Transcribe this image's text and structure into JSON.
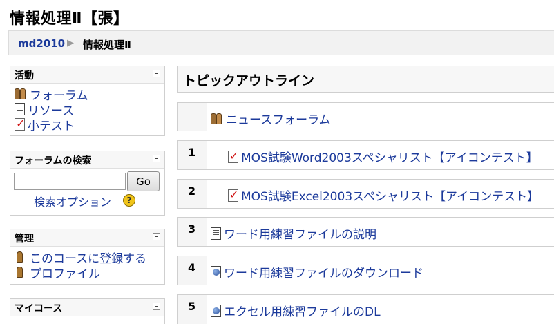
{
  "course": {
    "title": "情報処理Ⅱ【張】"
  },
  "breadcrumb": {
    "home": "md2010",
    "separator": "▶",
    "current": "情報処理Ⅱ"
  },
  "blocks": {
    "activities": {
      "title": "活動",
      "items": [
        {
          "label": "フォーラム",
          "icon": "forum-icon"
        },
        {
          "label": "リソース",
          "icon": "resource-icon"
        },
        {
          "label": "小テスト",
          "icon": "quiz-icon"
        }
      ]
    },
    "search": {
      "title": "フォーラムの検索",
      "input_value": "",
      "go_label": "Go",
      "advanced_label": "検索オプション",
      "help_symbol": "?"
    },
    "admin": {
      "title": "管理",
      "items": [
        {
          "label": "このコースに登録する",
          "icon": "enrol-icon"
        },
        {
          "label": "プロファイル",
          "icon": "profile-icon"
        }
      ]
    },
    "mycourses": {
      "title": "マイコース"
    }
  },
  "main": {
    "title": "トピックアウトライン",
    "sections": [
      {
        "number": "",
        "item": "ニュースフォーラム",
        "icon": "forum-icon"
      },
      {
        "number": "1",
        "item": "MOS試験Word2003スペシャリスト【アイコンテスト】",
        "icon": "quiz-icon"
      },
      {
        "number": "2",
        "item": "MOS試験Excel2003スペシャリスト【アイコンテスト】",
        "icon": "quiz-icon"
      },
      {
        "number": "3",
        "item": "ワード用練習ファイルの説明",
        "icon": "resource-icon"
      },
      {
        "number": "4",
        "item": "ワード用練習ファイルのダウンロード",
        "icon": "web-link-icon"
      },
      {
        "number": "5",
        "item": "エクセル用練習ファイルのDL",
        "icon": "web-link-icon"
      }
    ]
  }
}
